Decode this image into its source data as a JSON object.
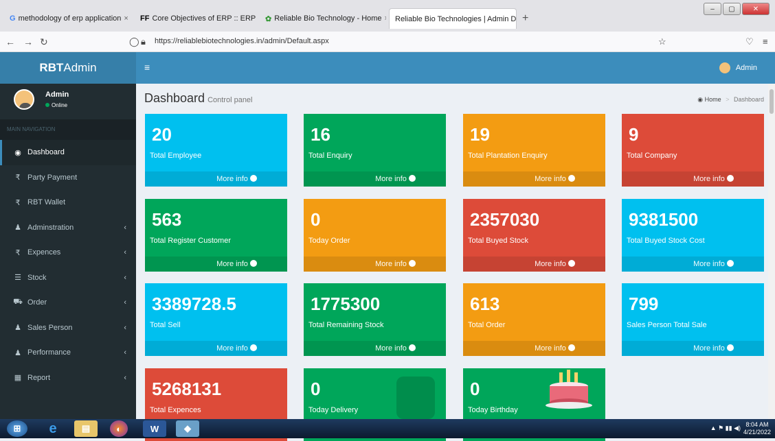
{
  "browser": {
    "tabs": [
      {
        "label": "methodology of erp application",
        "favicon": "G"
      },
      {
        "label": "Core Objectives of ERP :: ERP In",
        "favicon": "FF"
      },
      {
        "label": "Reliable Bio Technology - Home",
        "favicon": "leaf-icon"
      },
      {
        "label": "Reliable Bio Technologies | Admin D",
        "favicon": ""
      }
    ],
    "new_tab": "+",
    "url": "https://reliablebiotechnologies.in/admin/Default.aspx"
  },
  "app": {
    "logo_bold": "RBT",
    "logo_rest": " Admin",
    "user_name": "Admin",
    "user_status": "Online",
    "nav_header": "MAIN NAVIGATION",
    "menu": [
      {
        "label": "Dashboard",
        "icon": "dashboard-icon",
        "glyph": "◉",
        "chevron": ""
      },
      {
        "label": "Party Payment",
        "icon": "rupee-icon",
        "glyph": "₹",
        "chevron": ""
      },
      {
        "label": "RBT Wallet",
        "icon": "rupee-icon",
        "glyph": "₹",
        "chevron": ""
      },
      {
        "label": "Adminstration",
        "icon": "user-icon",
        "glyph": "♟",
        "chevron": "‹"
      },
      {
        "label": "Expences",
        "icon": "rupee-icon",
        "glyph": "₹",
        "chevron": "‹"
      },
      {
        "label": "Stock",
        "icon": "database-icon",
        "glyph": "☰",
        "chevron": "‹"
      },
      {
        "label": "Order",
        "icon": "cart-icon",
        "glyph": "⛟",
        "chevron": "‹"
      },
      {
        "label": "Sales Person",
        "icon": "users-icon",
        "glyph": "♟",
        "chevron": "‹"
      },
      {
        "label": "Performance",
        "icon": "user-icon",
        "glyph": "♟",
        "chevron": "‹"
      },
      {
        "label": "Report",
        "icon": "table-icon",
        "glyph": "▦",
        "chevron": "‹"
      }
    ],
    "topbar_user": "Admin",
    "page_title": "Dashboard",
    "page_subtitle": "Control panel",
    "breadcrumb_home": "Home",
    "breadcrumb_sep": ">",
    "breadcrumb_current": "Dashboard",
    "more_info": "More info",
    "boxes": [
      {
        "value": "20",
        "label": "Total Employee",
        "color": "#00c0ef"
      },
      {
        "value": "16",
        "label": "Total Enquiry",
        "color": "#00a65a"
      },
      {
        "value": "19",
        "label": "Total Plantation Enquiry",
        "color": "#f39c12"
      },
      {
        "value": "9",
        "label": "Total Company",
        "color": "#dd4b39"
      },
      {
        "value": "563",
        "label": "Total Register Customer",
        "color": "#00a65a"
      },
      {
        "value": "0",
        "label": "Today Order",
        "color": "#f39c12"
      },
      {
        "value": "2357030",
        "label": "Total Buyed Stock",
        "color": "#dd4b39"
      },
      {
        "value": "9381500",
        "label": "Total Buyed Stock Cost",
        "color": "#00c0ef"
      },
      {
        "value": "3389728.5",
        "label": "Total Sell",
        "color": "#00c0ef"
      },
      {
        "value": "1775300",
        "label": "Total Remaining Stock",
        "color": "#00a65a"
      },
      {
        "value": "613",
        "label": "Total Order",
        "color": "#f39c12"
      },
      {
        "value": "799",
        "label": "Sales Person Total Sale",
        "color": "#00c0ef"
      },
      {
        "value": "5268131",
        "label": "Total Expences",
        "color": "#dd4b39"
      },
      {
        "value": "0",
        "label": "Today Delivery",
        "color": "#00a65a"
      },
      {
        "value": "0",
        "label": "Today Birthday",
        "color": "#00a65a"
      }
    ]
  },
  "taskbar": {
    "time": "8:04 AM",
    "date": "4/21/2022"
  }
}
